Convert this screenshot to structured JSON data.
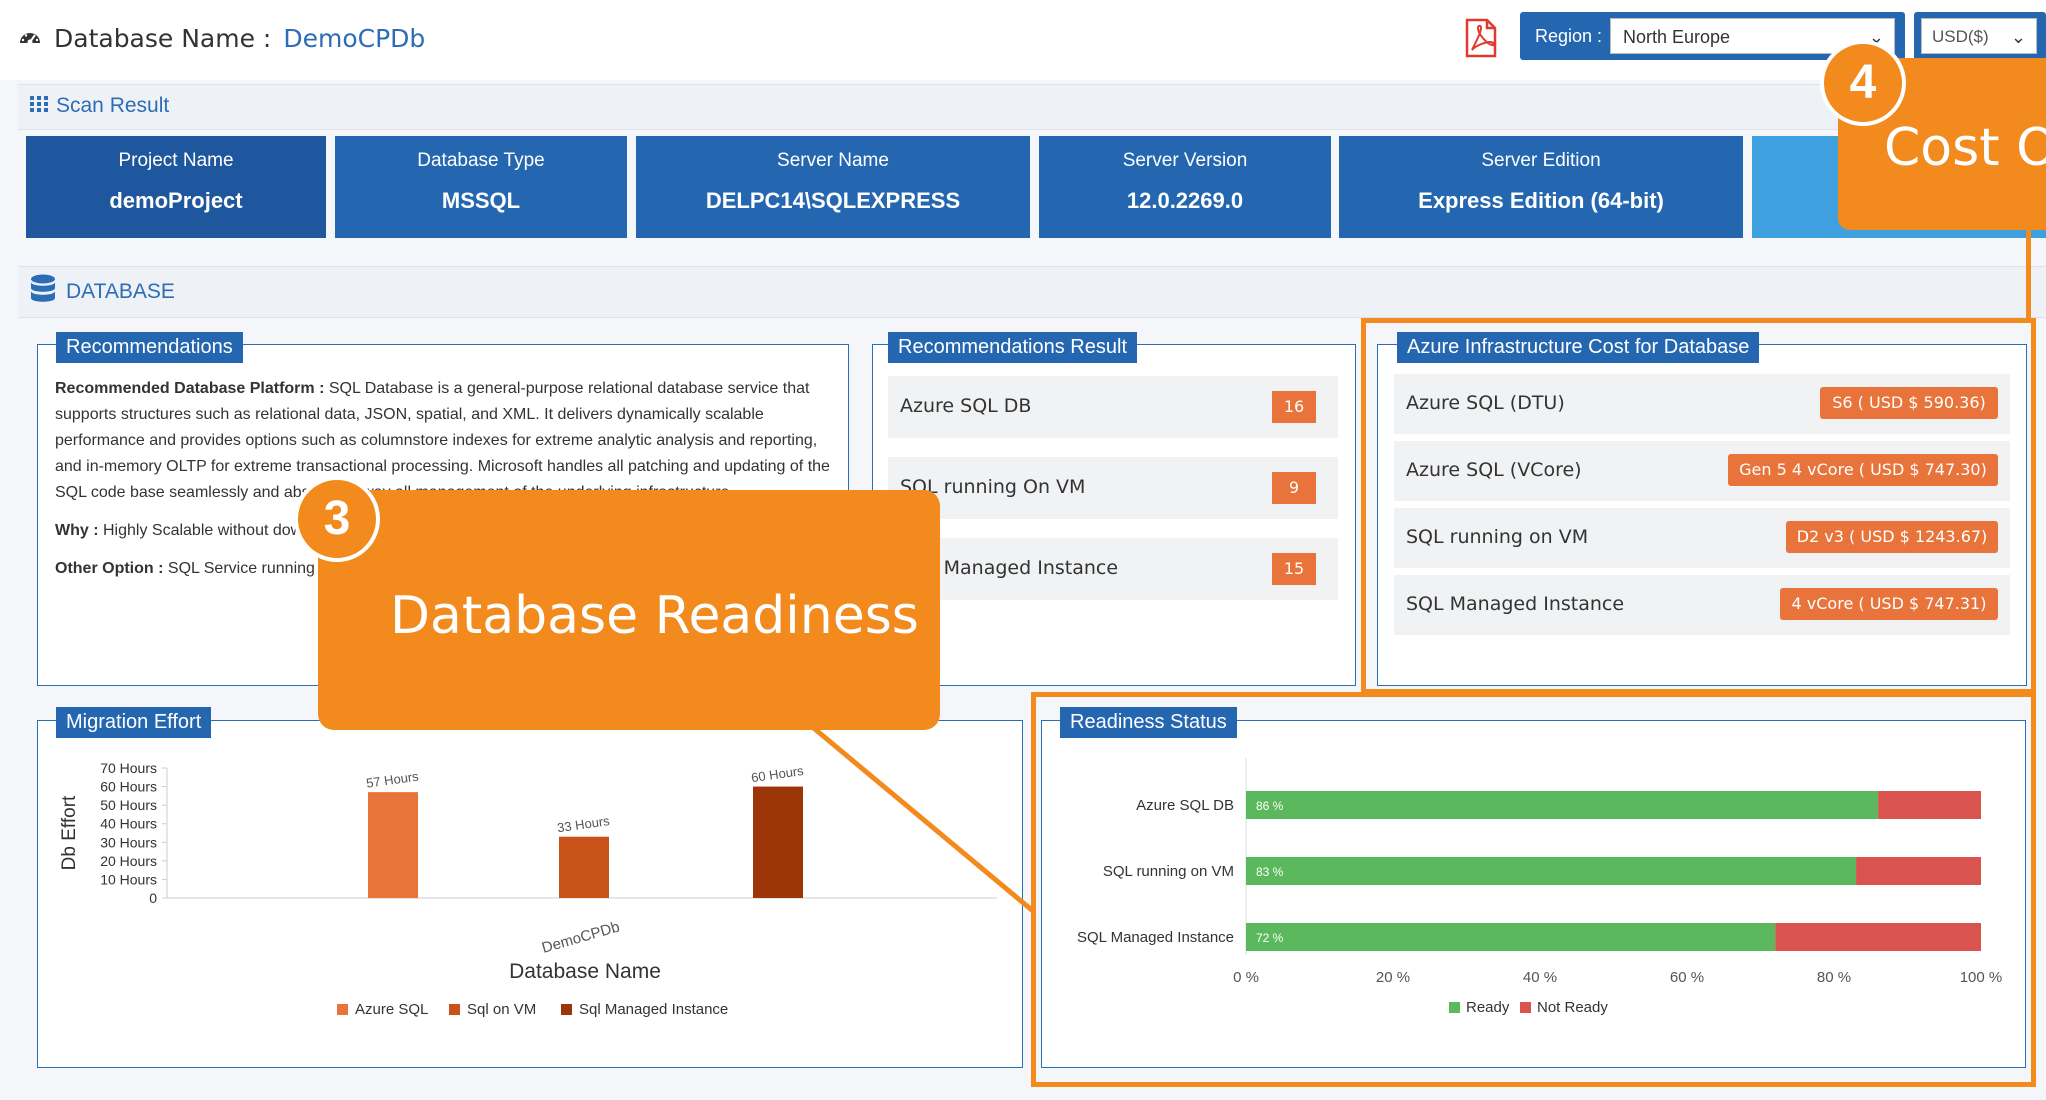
{
  "header": {
    "db_label": "Database Name :",
    "db_name": "DemoCPDb",
    "region_label": "Region :",
    "region_value": "North Europe",
    "currency_value": "USD($)"
  },
  "scan": {
    "label": "Scan Result",
    "cards": [
      {
        "title": "Project Name",
        "value": "demoProject"
      },
      {
        "title": "Database Type",
        "value": "MSSQL"
      },
      {
        "title": "Server Name",
        "value": "DELPC14\\SQLEXPRESS"
      },
      {
        "title": "Server Version",
        "value": "12.0.2269.0"
      },
      {
        "title": "Server Edition",
        "value": "Express Edition (64-bit)"
      }
    ]
  },
  "database": {
    "label": "DATABASE"
  },
  "recommendations": {
    "title": "Recommendations",
    "platform_label": "Recommended Database Platform :",
    "platform_text": "SQL Database is a general-purpose relational database service that supports structures such as relational data, JSON, spatial, and XML. It delivers dynamically scalable performance and provides options such as columnstore indexes for extreme analytic analysis and reporting, and in-memory OLTP for extreme transactional processing. Microsoft handles all patching and updating of the SQL code base seamlessly and abstracts away all management of the underlying infrastructure.",
    "why_label": "Why :",
    "why_text": "Highly Scalable without downtime, auditing , logging , query performance",
    "other_label": "Other Option :",
    "other_text": "SQL Service running on VM or SQL Managed instance."
  },
  "rec_result": {
    "title": "Recommendations Result",
    "items": [
      {
        "label": "Azure SQL DB",
        "count": "16"
      },
      {
        "label": "SQL running On VM",
        "count": "9"
      },
      {
        "label": "SQL Managed Instance",
        "count": "15"
      }
    ]
  },
  "infra_cost": {
    "title": "Azure Infrastructure Cost for Database",
    "items": [
      {
        "label": "Azure SQL (DTU)",
        "cost": "S6 ( USD $ 590.36)"
      },
      {
        "label": "Azure SQL (VCore)",
        "cost": "Gen 5 4 vCore ( USD $ 747.30)"
      },
      {
        "label": "SQL running on VM",
        "cost": "D2 v3 ( USD $ 1243.67)"
      },
      {
        "label": "SQL Managed Instance",
        "cost": "4 vCore ( USD $ 747.31)"
      }
    ]
  },
  "migration": {
    "title": "Migration Effort"
  },
  "readiness": {
    "title": "Readiness Status"
  },
  "callouts": {
    "c3_number": "3",
    "c3_text": "Database Readiness",
    "c4_number": "4",
    "c4_text": "Cost O"
  },
  "chart_data": [
    {
      "type": "bar",
      "title": "",
      "xlabel": "Database Name",
      "ylabel": "Db Effort",
      "categories": [
        "DemoCPDb"
      ],
      "ylim": [
        0,
        70
      ],
      "y_ticks": [
        "0",
        "10 Hours",
        "20 Hours",
        "30 Hours",
        "40 Hours",
        "50 Hours",
        "60 Hours",
        "70 Hours"
      ],
      "series": [
        {
          "name": "Azure SQL",
          "values": [
            57
          ],
          "label": "57 Hours",
          "color": "#e8743b"
        },
        {
          "name": "Sql on VM",
          "values": [
            33
          ],
          "label": "33 Hours",
          "color": "#c9521a"
        },
        {
          "name": "Sql Managed Instance",
          "values": [
            60
          ],
          "label": "60 Hours",
          "color": "#9c3508"
        }
      ],
      "legend": "bottom"
    },
    {
      "type": "bar",
      "orientation": "horizontal-stacked",
      "title": "",
      "categories": [
        "Azure SQL DB",
        "SQL running on VM",
        "SQL Managed Instance"
      ],
      "xlim": [
        0,
        100
      ],
      "x_ticks": [
        "0 %",
        "20 %",
        "40 %",
        "60 %",
        "80 %",
        "100 %"
      ],
      "series": [
        {
          "name": "Ready",
          "values": [
            86,
            83,
            72
          ],
          "labels": [
            "86 %",
            "83 %",
            "72 %"
          ],
          "color": "#5cb85c"
        },
        {
          "name": "Not Ready",
          "values": [
            14,
            17,
            28
          ],
          "color": "#d9534f"
        }
      ],
      "legend": "bottom"
    }
  ]
}
